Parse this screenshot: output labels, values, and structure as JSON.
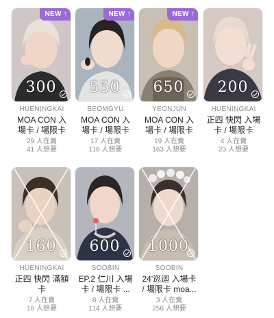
{
  "cards": [
    {
      "member": "HUENINGKAI",
      "title_line1": "MOA CON 入",
      "title_line2": "場卡 / 場限卡",
      "stat1": "29 人在賣",
      "stat2": "41 人想要",
      "badge": "NEW",
      "price": "300",
      "bg": "#cfc6c6",
      "skin": "#efd6c8",
      "hair": "#e9e2d9",
      "shirt": "#2b2b2b"
    },
    {
      "member": "BEOMGYU",
      "title_line1": "MOA CON 入",
      "title_line2": "場卡 / 場限卡",
      "stat1": "17 人在賣",
      "stat2": "118 人想要",
      "badge": "NEW",
      "price": "550",
      "bg": "#a9b4bf",
      "skin": "#f0dccf",
      "hair": "#2a2222",
      "shirt": "#e4e4e4"
    },
    {
      "member": "YEONJUN",
      "title_line1": "MOA CON 入",
      "title_line2": "場卡 / 場限卡",
      "stat1": "19 人在賣",
      "stat2": "163 人想要",
      "badge": "NEW",
      "price": "650",
      "bg": "#c8bfb5",
      "skin": "#f0d7c3",
      "hair": "#d8b98c",
      "shirt": "#8c7f73"
    },
    {
      "member": "HUENINGKAI",
      "title_line1": "正四 快閃 入場",
      "title_line2": "卡 / 場限卡",
      "stat1": "4 人在賣",
      "stat2": "23 人想要",
      "badge": "",
      "price": "200",
      "bg": "#d6c9c3",
      "skin": "#f3ded3",
      "hair": "#e8dcd0",
      "shirt": "#3a3a46"
    },
    {
      "member": "HUENINGKAI",
      "title_line1": "正四 快閃 滿額",
      "title_line2": "卡",
      "stat1": "7 人在賣",
      "stat2": "18 人想要",
      "badge": "",
      "price": "160",
      "bg": "#c9c0b9",
      "skin": "#ead2c2",
      "hair": "#3c2f28",
      "shirt": "#d9d0c4"
    },
    {
      "member": "SOOBIN",
      "title_line1": "EP.2 仁川 入場",
      "title_line2": "卡 / 場限卡 ...",
      "stat1": "8 人在賣",
      "stat2": "114 人想要",
      "badge": "",
      "price": "600",
      "bg": "#b3b7bd",
      "skin": "#efd8cb",
      "hair": "#2a2424",
      "shirt": "#2e3446"
    },
    {
      "member": "SOOBIN",
      "title_line1": "24'巡迴 入場卡",
      "title_line2": "/ 場限卡 moa...",
      "stat1": "3 人在賣",
      "stat2": "256 人想要",
      "badge": "",
      "price": "1000",
      "bg": "#b6afaa",
      "skin": "#efd9cd",
      "hair": "#3a302d",
      "shirt": "#c9bcb0"
    }
  ]
}
